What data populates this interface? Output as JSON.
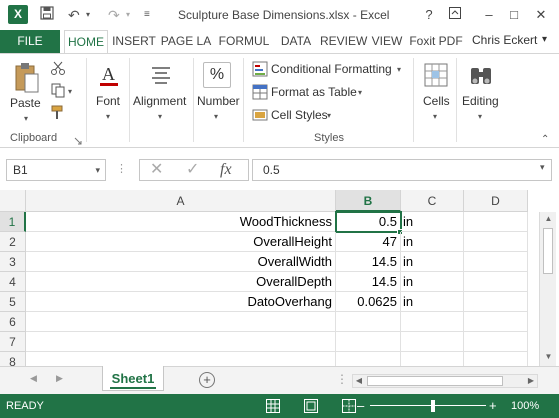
{
  "app": {
    "logo": "X",
    "title": "Sculpture Base Dimensions.xlsx - Excel",
    "window_controls": {
      "help": "?",
      "restore": "⧉",
      "minimize": "–",
      "maximize": "□",
      "close": "✕"
    },
    "qat": {
      "undo": "↶",
      "redo": "↷",
      "save": "💾",
      "customize": "≡"
    }
  },
  "ribbon_tabs": {
    "file": "FILE",
    "items": [
      "HOME",
      "INSERT",
      "PAGE LA",
      "FORMUL",
      "DATA",
      "REVIEW",
      "VIEW",
      "Foxit PDF"
    ],
    "active": "HOME",
    "user": "Chris Eckert"
  },
  "ribbon": {
    "clipboard": {
      "paste": "Paste",
      "group": "Clipboard"
    },
    "font": {
      "label": "Font"
    },
    "alignment": {
      "label": "Alignment"
    },
    "number": {
      "label": "Number",
      "symbol": "%"
    },
    "styles": {
      "conditional": "Conditional Formatting",
      "table": "Format as Table",
      "cell_styles": "Cell Styles",
      "group": "Styles"
    },
    "cells": {
      "label": "Cells"
    },
    "editing": {
      "label": "Editing"
    }
  },
  "formula_bar": {
    "name_box": "B1",
    "cancel": "✕",
    "enter": "✓",
    "fx": "fx",
    "value": "0.5"
  },
  "grid": {
    "columns": [
      "A",
      "B",
      "C",
      "D"
    ],
    "selected_column": "B",
    "rows": [
      "1",
      "2",
      "3",
      "4",
      "5",
      "6",
      "7",
      "8"
    ],
    "selected_row": "1",
    "data": [
      {
        "a": "WoodThickness",
        "b": "0.5",
        "c": "in"
      },
      {
        "a": "OverallHeight",
        "b": "47",
        "c": "in"
      },
      {
        "a": "OverallWidth",
        "b": "14.5",
        "c": "in"
      },
      {
        "a": "OverallDepth",
        "b": "14.5",
        "c": "in"
      },
      {
        "a": "DatoOverhang",
        "b": "0.0625",
        "c": "in"
      }
    ]
  },
  "sheets": {
    "tabs": [
      "Sheet1"
    ],
    "active": "Sheet1"
  },
  "status": {
    "ready": "READY",
    "zoom": "100%",
    "zoom_minus": "–",
    "zoom_plus": "+"
  },
  "colors": {
    "accent": "#217346"
  }
}
